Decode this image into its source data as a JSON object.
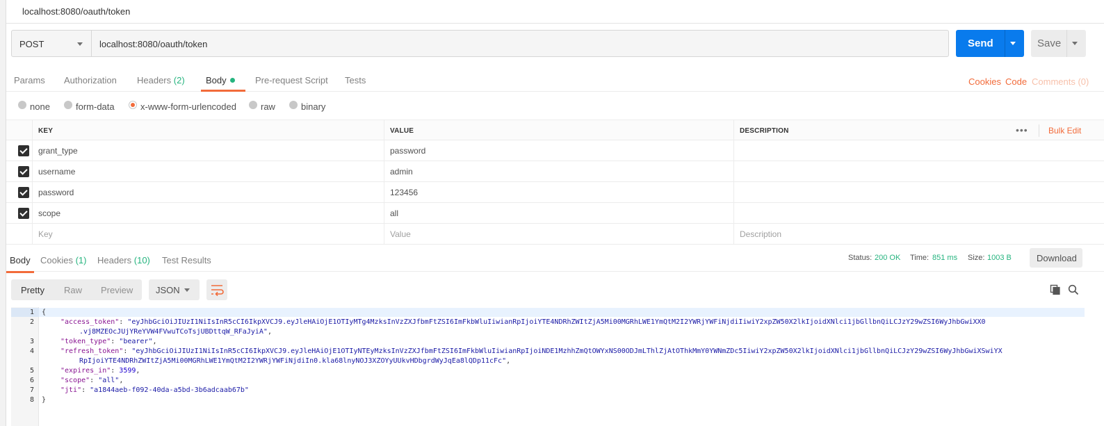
{
  "window": {
    "title": "localhost:8080/oauth/token"
  },
  "request": {
    "method": "POST",
    "url": "localhost:8080/oauth/token",
    "send_label": "Send",
    "save_label": "Save"
  },
  "request_tabs": {
    "params": "Params",
    "authorization": "Authorization",
    "headers": "Headers",
    "headers_count": "(2)",
    "body": "Body",
    "prerequest": "Pre-request Script",
    "tests": "Tests",
    "cookies": "Cookies",
    "code": "Code",
    "comments": "Comments (0)"
  },
  "body_types": {
    "none": "none",
    "form_data": "form-data",
    "urlencoded": "x-www-form-urlencoded",
    "raw": "raw",
    "binary": "binary",
    "selected": "x-www-form-urlencoded"
  },
  "params_table": {
    "headers": {
      "key": "KEY",
      "value": "VALUE",
      "description": "DESCRIPTION",
      "bulk_edit": "Bulk Edit"
    },
    "rows": [
      {
        "key": "grant_type",
        "value": "password",
        "checked": true
      },
      {
        "key": "username",
        "value": "admin",
        "checked": true
      },
      {
        "key": "password",
        "value": "123456",
        "checked": true
      },
      {
        "key": "scope",
        "value": "all",
        "checked": true
      }
    ],
    "placeholder": {
      "key": "Key",
      "value": "Value",
      "description": "Description"
    }
  },
  "response_tabs": {
    "body": "Body",
    "cookies": "Cookies",
    "cookies_count": "(1)",
    "headers": "Headers",
    "headers_count": "(10)",
    "test_results": "Test Results"
  },
  "response_meta": {
    "status_label": "Status:",
    "status_value": "200 OK",
    "time_label": "Time:",
    "time_value": "851 ms",
    "size_label": "Size:",
    "size_value": "1003 B",
    "download": "Download"
  },
  "view": {
    "pretty": "Pretty",
    "raw": "Raw",
    "preview": "Preview",
    "format": "JSON"
  },
  "response_body": {
    "line_numbers": [
      "1",
      "2",
      "3",
      "4",
      "5",
      "6",
      "7",
      "8"
    ],
    "open_brace": "{",
    "close_brace": "}",
    "access_token_key": "\"access_token\"",
    "access_token_1": "\"eyJhbGciOiJIUzI1NiIsInR5cCI6IkpXVCJ9.eyJleHAiOjE1OTIyMTg4MzksInVzZXJfbmFtZSI6ImFkbWluIiwianRpIjoiYTE4NDRhZWItZjA5Mi00MGRhLWE1YmQtM2I2YWRjYWFiNjdiIiwiY2xpZW50X2lkIjoidXNlci1jbGllbnQiLCJzY29wZSI6WyJhbGwiXX0",
    "access_token_2": ".vj8MZEOcJUjYReYVW4FVwuTCoTsjUBDttqW_RFaJyiA\"",
    "token_type_key": "\"token_type\"",
    "token_type_val": "\"bearer\"",
    "refresh_token_key": "\"refresh_token\"",
    "refresh_token_1": "\"eyJhbGciOiJIUzI1NiIsInR5cCI6IkpXVCJ9.eyJleHAiOjE1OTIyNTEyMzksInVzZXJfbmFtZSI6ImFkbWluIiwianRpIjoiNDE1MzhhZmQtOWYxNS00ODJmLThlZjAtOThkMmY0YWNmZDc5IiwiY2xpZW50X2lkIjoidXNlci1jbGllbnQiLCJzY29wZSI6WyJhbGwiXSwiYX",
    "refresh_token_2": "RpIjoiYTE4NDRhZWItZjA5Mi00MGRhLWE1YmQtM2I2YWRjYWFiNjdiIn0.kla68lnyNOJ3XZOYyUUkvHDbgrdWyJqEa8lQDp11cFc\"",
    "expires_in_key": "\"expires_in\"",
    "expires_in_val": "3599",
    "scope_key": "\"scope\"",
    "scope_val": "\"all\"",
    "jti_key": "\"jti\"",
    "jti_val": "\"a1844aeb-f092-40da-a5bd-3b6adcaab67b\""
  },
  "colors": {
    "accent": "#f26b3a",
    "primary": "#097bed",
    "success": "#26b47f"
  }
}
